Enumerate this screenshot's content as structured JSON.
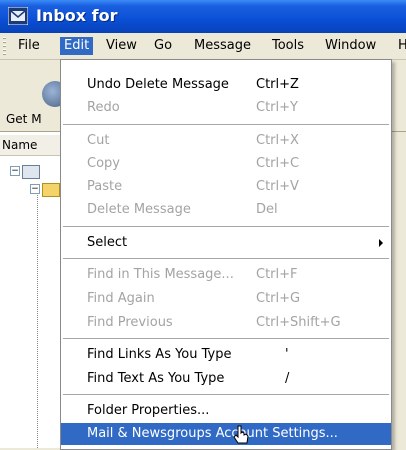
{
  "window": {
    "title": "Inbox for"
  },
  "menubar": [
    {
      "label": "File"
    },
    {
      "label": "Edit"
    },
    {
      "label": "View"
    },
    {
      "label": "Go"
    },
    {
      "label": "Message"
    },
    {
      "label": "Tools"
    },
    {
      "label": "Window"
    },
    {
      "label": "H"
    }
  ],
  "toolbar": {
    "get_label": "Get M"
  },
  "pane": {
    "column_name": "Name"
  },
  "edit_menu": {
    "items": [
      {
        "label": "Undo Delete Message",
        "shortcut": "Ctrl+Z"
      },
      {
        "label": "Redo",
        "shortcut": "Ctrl+Y"
      },
      {
        "label": "Cut",
        "shortcut": "Ctrl+X"
      },
      {
        "label": "Copy",
        "shortcut": "Ctrl+C"
      },
      {
        "label": "Paste",
        "shortcut": "Ctrl+V"
      },
      {
        "label": "Delete Message",
        "shortcut": "Del"
      },
      {
        "label": "Select",
        "shortcut": ""
      },
      {
        "label": "Find in This Message...",
        "shortcut": "Ctrl+F"
      },
      {
        "label": "Find Again",
        "shortcut": "Ctrl+G"
      },
      {
        "label": "Find Previous",
        "shortcut": "Ctrl+Shift+G"
      },
      {
        "label": "Find Links As You Type",
        "shortcut": "'"
      },
      {
        "label": "Find Text As You Type",
        "shortcut": "/"
      },
      {
        "label": "Folder Properties...",
        "shortcut": ""
      },
      {
        "label": "Mail & Newsgroups Account Settings...",
        "shortcut": ""
      }
    ]
  },
  "colors": {
    "highlight": "#316ac5",
    "titlebar": "#0a4fd6",
    "disabled_text": "#a4a3a2"
  },
  "icons": [
    "app-icon",
    "get-mail-icon",
    "mail-account-icon",
    "folder-icon",
    "submenu-arrow-icon",
    "mouse-cursor-icon"
  ]
}
